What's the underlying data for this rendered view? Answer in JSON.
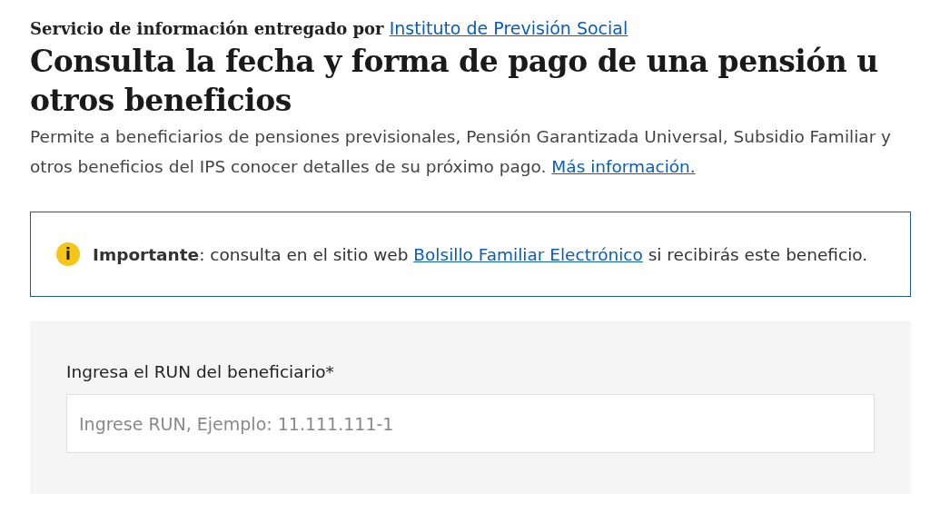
{
  "provider": {
    "prefix": "Servicio de información entregado por",
    "link": "Instituto de Previsión Social"
  },
  "title": "Consulta la fecha y forma de pago de una pensión u otros beneficios",
  "description": {
    "text": "Permite a beneficiarios de pensiones previsionales, Pensión Garantizada Universal, Subsidio Familiar y otros beneficios del IPS conocer detalles de su próximo pago.",
    "link": "Más información."
  },
  "notice": {
    "icon_text": "i",
    "text_before": "**Importante**: consulta en el sitio web",
    "link": "Bolsillo Familiar Electrónico",
    "text_after": "si recibirás este beneficio."
  },
  "form": {
    "label": "Ingresa el RUN del beneficiario*",
    "placeholder": "Ingrese RUN, Ejemplo: 11.111.111-1"
  }
}
